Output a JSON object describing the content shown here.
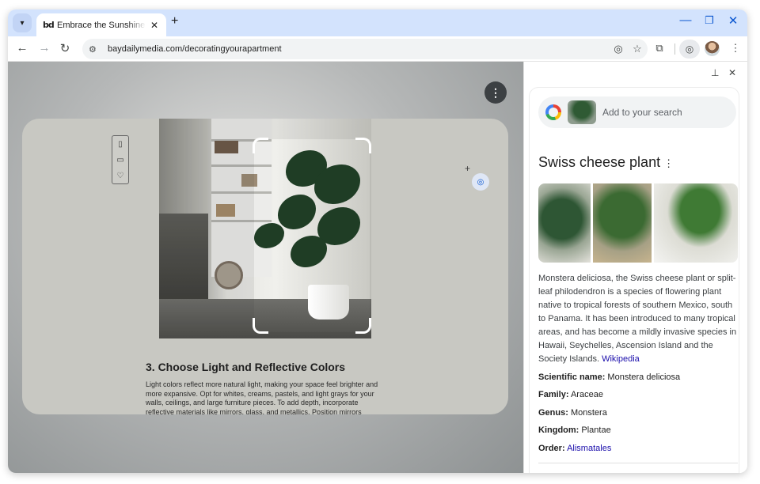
{
  "browser": {
    "tab": {
      "favicon_text": "bd",
      "title": "Embrace the Sunshine: Decorating your apartment",
      "close": "✕"
    },
    "new_tab": "+",
    "window_controls": {
      "minimize": "—",
      "restore": "❐",
      "close": "✕"
    },
    "url": "baydailymedia.com/decoratingyourapartment",
    "accent_color": "#0b57d0",
    "tabstrip_color": "#d3e3fd"
  },
  "article": {
    "heading": "3. Choose Light and Reflective Colors",
    "body": "Light colors reflect more natural light, making your space feel brighter and more expansive. Opt for whites, creams, pastels, and light grays for your walls, ceilings, and large furniture pieces. To add depth, incorporate reflective materials like mirrors, glass, and metallics. Position mirrors"
  },
  "side_panel": {
    "search_placeholder": "Add to your search",
    "result_title": "Swiss cheese plant",
    "description": "Monstera deliciosa, the Swiss cheese plant or split-leaf philodendron is a species of flowering plant native to tropical forests of southern Mexico, south to Panama. It has been introduced to many tropical areas, and has become a mildly invasive species in Hawaii, Seychelles, Ascension Island and the Society Islands.",
    "source_link": "Wikipedia",
    "facts": [
      {
        "label": "Scientific name:",
        "value": "Monstera deliciosa",
        "is_link": false
      },
      {
        "label": "Family:",
        "value": "Araceae",
        "is_link": false
      },
      {
        "label": "Genus:",
        "value": "Monstera",
        "is_link": false
      },
      {
        "label": "Kingdom:",
        "value": "Plantae",
        "is_link": false
      },
      {
        "label": "Order:",
        "value": "Alismatales",
        "is_link": true
      }
    ]
  }
}
